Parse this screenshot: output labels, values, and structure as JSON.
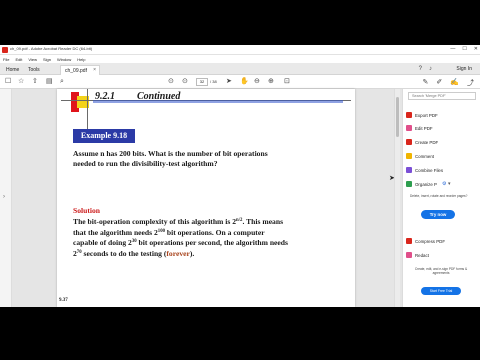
{
  "window": {
    "title": "ch_09.pdf - Adobe Acrobat Reader DC (64-bit)",
    "minimize_glyph": "—",
    "maximize_glyph": "☐",
    "close_glyph": "✕"
  },
  "menu": [
    "File",
    "Edit",
    "View",
    "Sign",
    "Window",
    "Help"
  ],
  "tabs": {
    "home": "Home",
    "tools": "Tools",
    "document": "ch_09.pdf",
    "close_glyph": "×"
  },
  "account": {
    "sign_in": "Sign In"
  },
  "toolbar": {
    "page_current": "32",
    "page_total": "/ 38"
  },
  "document": {
    "section_number": "9.2.1",
    "section_title": "Continued",
    "example_label": "Example 9.18",
    "question_line1": "Assume n has 200 bits. What is the number of bit operations",
    "question_line2": "needed to run the divisibility-test algorithm?",
    "solution_label": "Solution",
    "page_number": "9.37",
    "exp_n_half": "n/2",
    "exp_100": "100",
    "exp_30": "30",
    "exp_70": "70",
    "forever_word": "forever"
  },
  "tools_panel": {
    "search_placeholder": "Search 'Merge PDF'",
    "items": [
      "Export PDF",
      "Edit PDF",
      "Create PDF",
      "Comment",
      "Combine Files",
      "Organize P"
    ],
    "promo_text": "Delete, insert, rotate and reorder pages?",
    "try_now": "Try now",
    "bottom_items": [
      "Compress PDF",
      "Redact"
    ],
    "promo2_text": "Create, edit, and e-sign PDF forms & agreements",
    "free_trial": "Start Free Trial"
  },
  "colors": {
    "accent": "#1473e6",
    "example_box": "#2b3aa6",
    "solution_red": "#cc1a1a",
    "forever": "#a8441d"
  }
}
